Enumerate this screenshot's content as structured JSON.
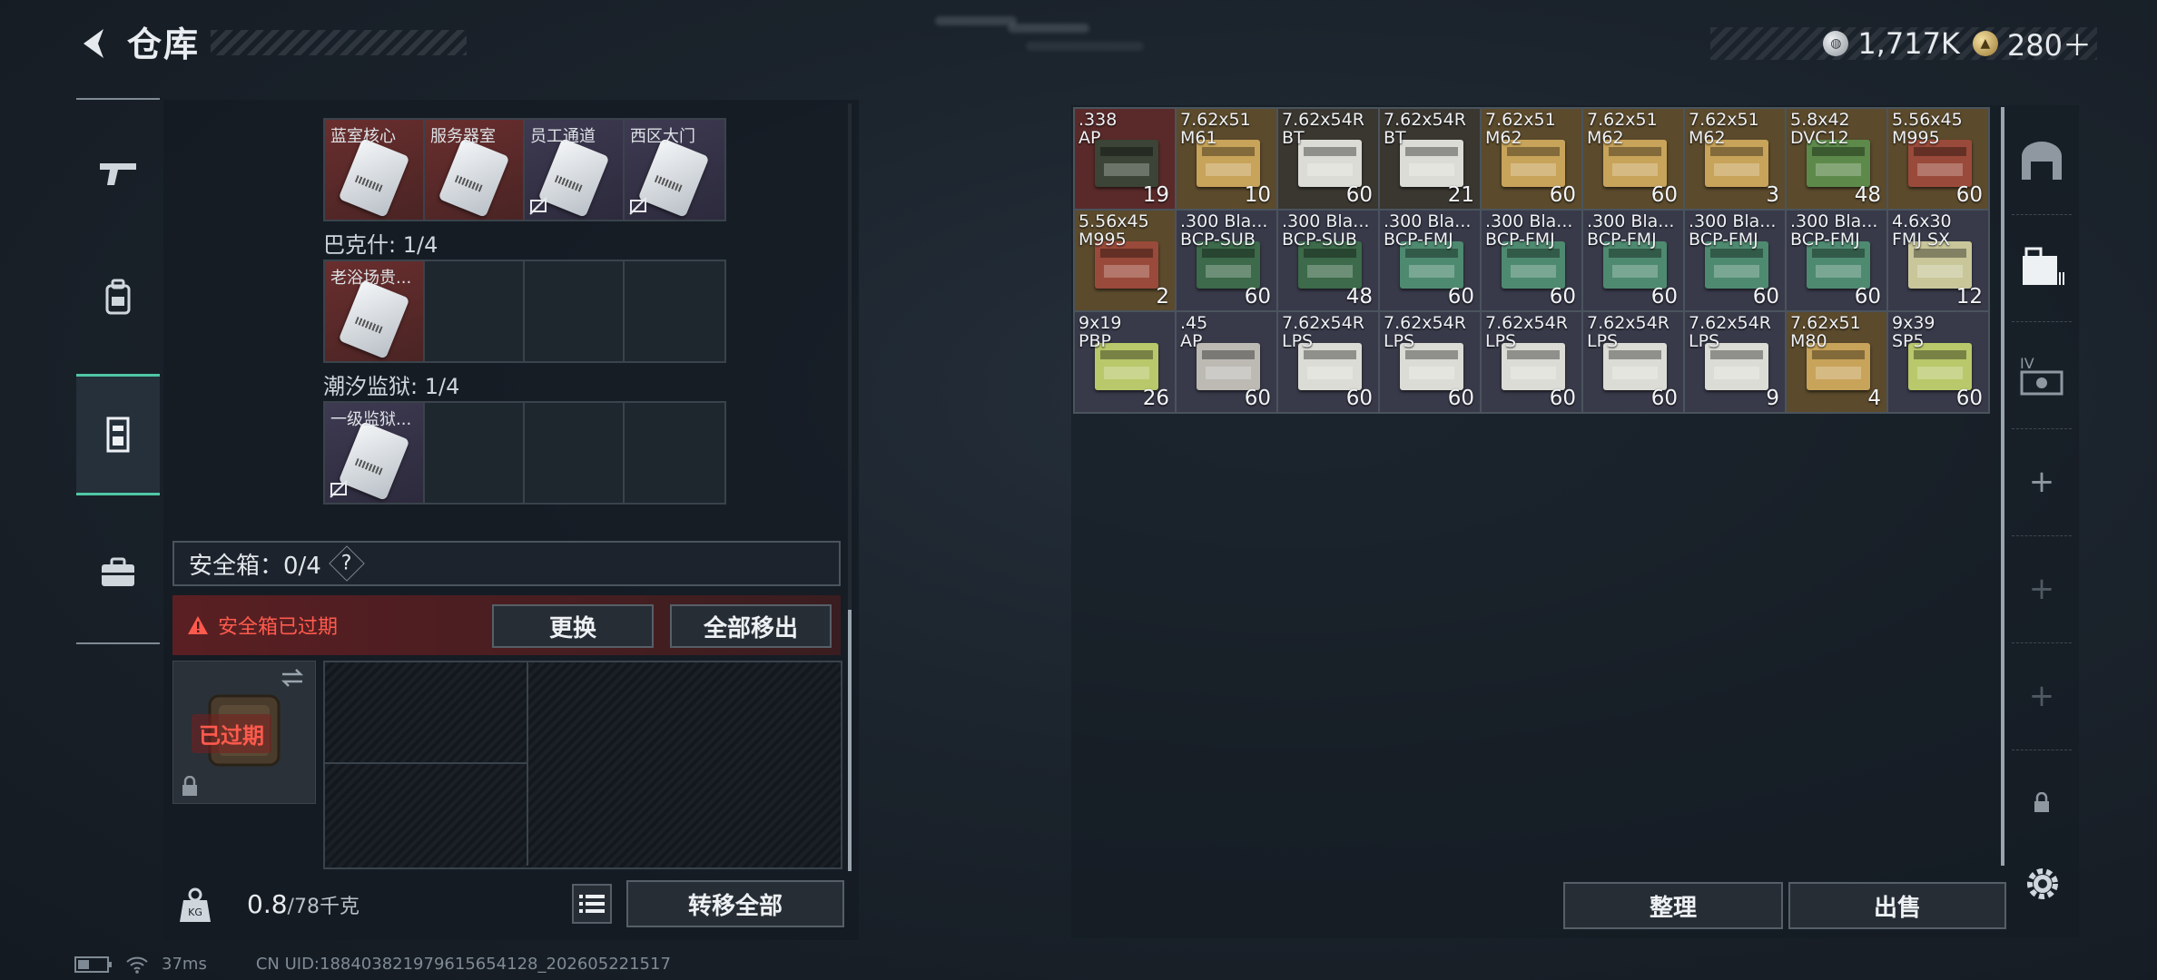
{
  "header": {
    "title": "仓库",
    "currency_silver": "1,717K",
    "currency_gold": "280＋"
  },
  "left_nav": {
    "items": [
      "weapon-icon",
      "backpack-icon",
      "vest-icon",
      "medkit-icon"
    ],
    "active": "vest-icon"
  },
  "key_groups": [
    {
      "label": "",
      "slots": [
        {
          "name": "蓝室核心",
          "bg": "red",
          "bound": true
        },
        {
          "name": "服务器室",
          "bg": "red",
          "bound": true
        },
        {
          "name": "员工通道",
          "bg": "pur",
          "bound": false
        },
        {
          "name": "西区大门",
          "bg": "pur",
          "bound": false
        }
      ]
    },
    {
      "label": "巴克什: 1/4",
      "slots": [
        {
          "name": "老浴场贵...",
          "bg": "red",
          "bound": true
        },
        {
          "name": "",
          "bg": "empty"
        },
        {
          "name": "",
          "bg": "empty"
        },
        {
          "name": "",
          "bg": "empty"
        }
      ]
    },
    {
      "label": "潮汐监狱: 1/4",
      "slots": [
        {
          "name": "一级监狱...",
          "bg": "pur",
          "bound": false
        },
        {
          "name": "",
          "bg": "empty"
        },
        {
          "name": "",
          "bg": "empty"
        },
        {
          "name": "",
          "bg": "empty"
        }
      ]
    }
  ],
  "safe_case": {
    "label": "安全箱：0/4",
    "help": "?",
    "expired_notice": "安全箱已过期",
    "replace_button": "更换",
    "remove_all_button": "全部移出",
    "thumb_overlay": "已过期"
  },
  "footer_left": {
    "weight_value": "0.8",
    "weight_capacity": "/78千克",
    "transfer_all_button": "转移全部"
  },
  "inventory": [
    {
      "name": ".338\nAP",
      "qty": "19",
      "bg": "#5a2a2a",
      "box": "#3b4436"
    },
    {
      "name": "7.62x51\nM61",
      "qty": "10",
      "bg": "#5b4a2c",
      "box": "#c8a35a"
    },
    {
      "name": "7.62x54R\nBT",
      "qty": "60",
      "bg": "#3a3630",
      "box": "#dcdcd6"
    },
    {
      "name": "7.62x54R\nBT",
      "qty": "21",
      "bg": "#3a3630",
      "box": "#dcdcd6"
    },
    {
      "name": "7.62x51\nM62",
      "qty": "60",
      "bg": "#5b4a2c",
      "box": "#c8a35a"
    },
    {
      "name": "7.62x51\nM62",
      "qty": "60",
      "bg": "#5b4a2c",
      "box": "#c8a35a"
    },
    {
      "name": "7.62x51\nM62",
      "qty": "3",
      "bg": "#5b4a2c",
      "box": "#c8a35a"
    },
    {
      "name": "5.8x42\nDVC12",
      "qty": "48",
      "bg": "#5b4a2c",
      "box": "#5d8a4a"
    },
    {
      "name": "5.56x45\nM995",
      "qty": "60",
      "bg": "#5b4a2c",
      "box": "#9a4a3a"
    },
    {
      "name": "5.56x45\nM995",
      "qty": "2",
      "bg": "#5b4a2c",
      "box": "#9a4a3a"
    },
    {
      "name": ".300 Bla...\nBCP-SUB",
      "qty": "60",
      "bg": "#383a4a",
      "box": "#3c6a4a"
    },
    {
      "name": ".300 Bla...\nBCP-SUB",
      "qty": "48",
      "bg": "#383a4a",
      "box": "#3c6a4a"
    },
    {
      "name": ".300 Bla...\nBCP-FMJ",
      "qty": "60",
      "bg": "#383a4a",
      "box": "#4e8a70"
    },
    {
      "name": ".300 Bla...\nBCP-FMJ",
      "qty": "60",
      "bg": "#383a4a",
      "box": "#4e8a70"
    },
    {
      "name": ".300 Bla...\nBCP-FMJ",
      "qty": "60",
      "bg": "#383a4a",
      "box": "#4e8a70"
    },
    {
      "name": ".300 Bla...\nBCP-FMJ",
      "qty": "60",
      "bg": "#383a4a",
      "box": "#4e8a70"
    },
    {
      "name": ".300 Bla...\nBCP-FMJ",
      "qty": "60",
      "bg": "#383a4a",
      "box": "#4e8a70"
    },
    {
      "name": "4.6x30\nFMJ SX",
      "qty": "12",
      "bg": "#383a4a",
      "box": "#c9c79a"
    },
    {
      "name": "9x19\nPBP",
      "qty": "26",
      "bg": "#383a4a",
      "box": "#b9c86a"
    },
    {
      "name": ".45\nAP",
      "qty": "60",
      "bg": "#383a4a",
      "box": "#bdbab4"
    },
    {
      "name": "7.62x54R\nLPS",
      "qty": "60",
      "bg": "#383a4a",
      "box": "#dcdcd6"
    },
    {
      "name": "7.62x54R\nLPS",
      "qty": "60",
      "bg": "#383a4a",
      "box": "#dcdcd6"
    },
    {
      "name": "7.62x54R\nLPS",
      "qty": "60",
      "bg": "#383a4a",
      "box": "#dcdcd6"
    },
    {
      "name": "7.62x54R\nLPS",
      "qty": "60",
      "bg": "#383a4a",
      "box": "#dcdcd6"
    },
    {
      "name": "7.62x54R\nLPS",
      "qty": "9",
      "bg": "#383a4a",
      "box": "#dcdcd6"
    },
    {
      "name": "7.62x51\nM80",
      "qty": "4",
      "bg": "#5b4a2c",
      "box": "#c8a35a"
    },
    {
      "name": "9x39\nSP5",
      "qty": "60",
      "bg": "#383a4a",
      "box": "#b9c86a"
    }
  ],
  "right_footer": {
    "sort_button": "整理",
    "sell_button": "出售"
  },
  "right_side": {
    "items": [
      "stash-icon",
      "container-icon",
      "storage-icon",
      "add-icon",
      "add-icon",
      "add-icon",
      "lock-icon"
    ]
  },
  "status_bar": {
    "ping": "37ms",
    "uid": "CN UID:188403821979615654128_202605221517"
  }
}
